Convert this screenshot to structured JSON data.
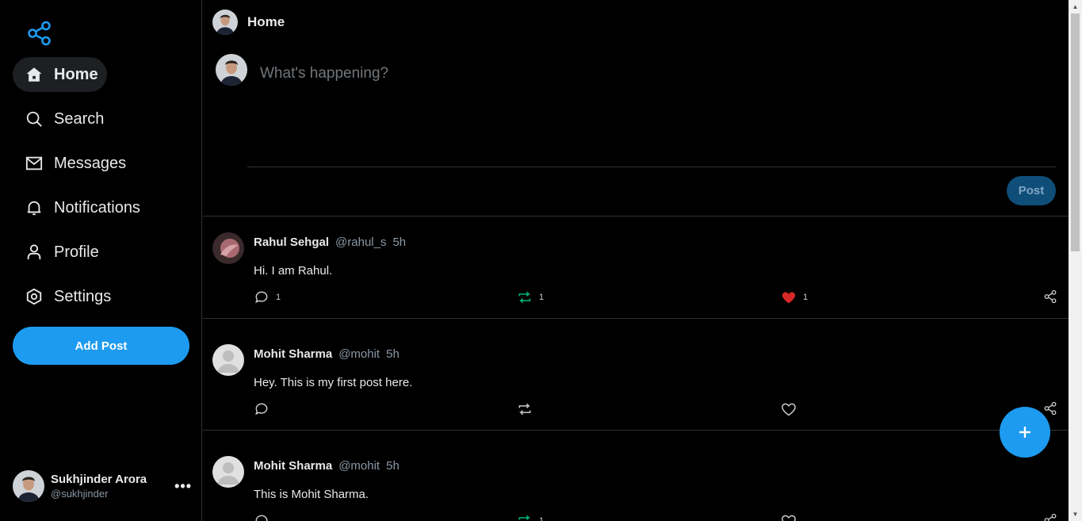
{
  "sidebar": {
    "logo_icon": "share-nodes-icon",
    "items": [
      {
        "label": "Home",
        "icon": "home-icon",
        "active": true
      },
      {
        "label": "Search",
        "icon": "search-icon"
      },
      {
        "label": "Messages",
        "icon": "envelope-icon"
      },
      {
        "label": "Notifications",
        "icon": "bell-icon"
      },
      {
        "label": "Profile",
        "icon": "user-icon"
      },
      {
        "label": "Settings",
        "icon": "gear-icon"
      }
    ],
    "add_post_label": "Add Post",
    "account": {
      "name": "Sukhjinder Arora",
      "handle": "@sukhjinder",
      "more": "•••"
    }
  },
  "header": {
    "title": "Home"
  },
  "composer": {
    "placeholder": "What's happening?",
    "post_label": "Post"
  },
  "posts": [
    {
      "name": "Rahul Sehgal",
      "handle": "@rahul_s",
      "time": "5h",
      "text": "Hi. I am Rahul.",
      "replies": "1",
      "reposts": "1",
      "likes": "1",
      "liked": true,
      "reposted": true
    },
    {
      "name": "Mohit Sharma",
      "handle": "@mohit",
      "time": "5h",
      "text": "Hey. This is my first post here.",
      "replies": "",
      "reposts": "",
      "likes": "",
      "liked": false,
      "reposted": false
    },
    {
      "name": "Mohit Sharma",
      "handle": "@mohit",
      "time": "5h",
      "text": "This is Mohit Sharma.",
      "replies": "",
      "reposts": "1",
      "likes": "",
      "liked": false,
      "reposted": true
    }
  ],
  "fab_icon": "plus-icon",
  "colors": {
    "accent": "#1d9bf0",
    "like": "#f91880",
    "repost": "#00ba7c"
  }
}
